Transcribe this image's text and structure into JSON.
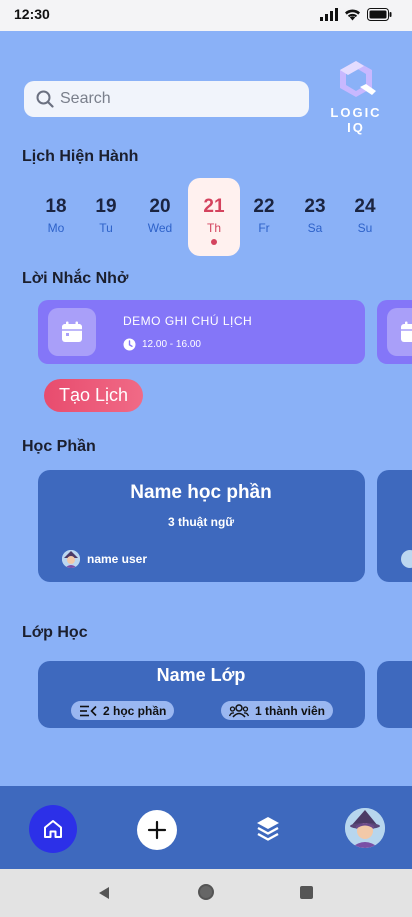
{
  "status": {
    "time": "12:30"
  },
  "search": {
    "placeholder": "Search"
  },
  "logo": {
    "text": "LOGIC IQ"
  },
  "calendar": {
    "title": "Lịch Hiện Hành",
    "days": [
      {
        "num": "18",
        "name": "Mo"
      },
      {
        "num": "19",
        "name": "Tu"
      },
      {
        "num": "20",
        "name": "Wed"
      },
      {
        "num": "21",
        "name": "Th"
      },
      {
        "num": "22",
        "name": "Fr"
      },
      {
        "num": "23",
        "name": "Sa"
      },
      {
        "num": "24",
        "name": "Su"
      }
    ],
    "selected_index": 3
  },
  "reminders": {
    "title": "Lời Nhắc Nhở",
    "items": [
      {
        "title": "DEMO GHI CHÚ LỊCH",
        "time": "12.00 - 16.00"
      }
    ]
  },
  "create_button": {
    "label": "Tạo Lịch"
  },
  "modules": {
    "title": "Học Phần",
    "items": [
      {
        "name": "Name học phần",
        "count": "3 thuật ngữ",
        "user": "name user"
      }
    ]
  },
  "classes": {
    "title": "Lớp Học",
    "items": [
      {
        "name": "Name Lớp",
        "modules": "2 học phần",
        "members": "1 thành viên"
      }
    ]
  },
  "colors": {
    "background": "#8ab1f7",
    "card": "#3e69be",
    "reminder": "#8476f8",
    "accent": "#d4435e",
    "nav_active": "#2c30e8"
  },
  "icons": {
    "search": "search-icon",
    "calendar": "calendar-icon",
    "clock": "clock-icon",
    "home": "home-icon",
    "add": "plus-icon",
    "layers": "layers-icon"
  }
}
